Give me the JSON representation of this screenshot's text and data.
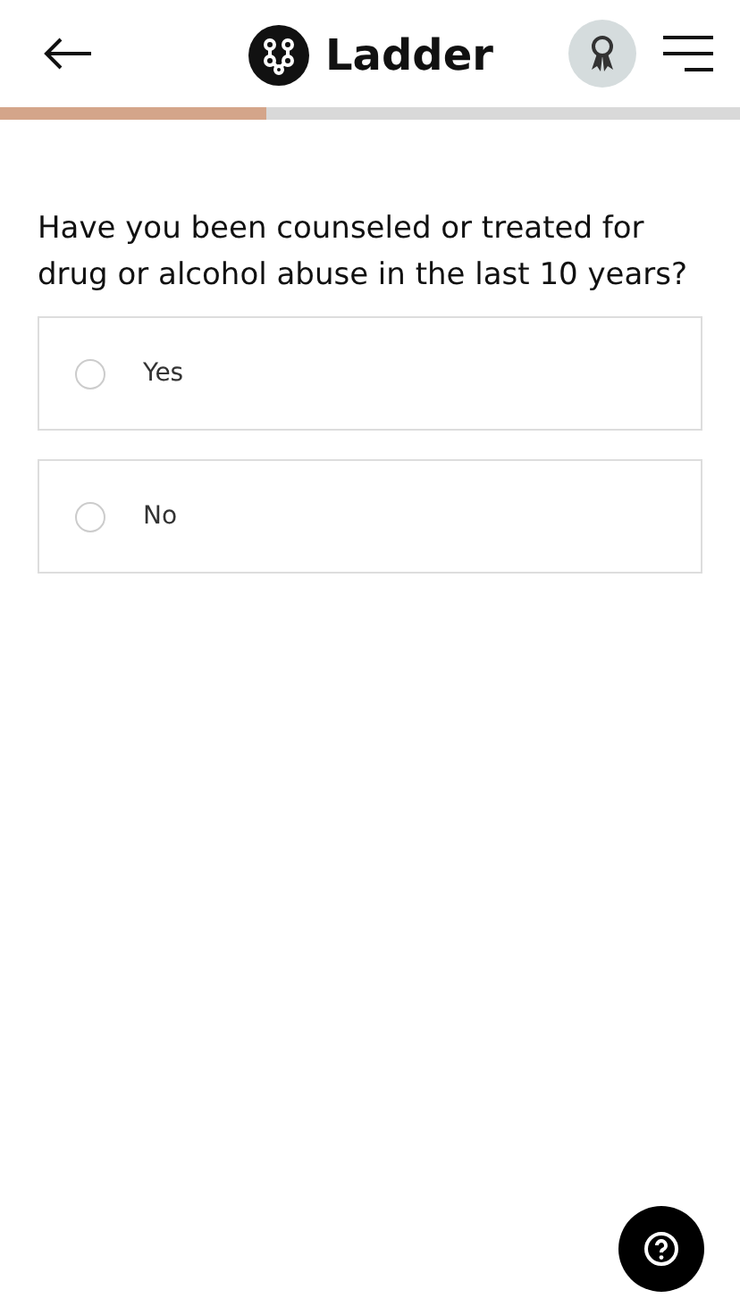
{
  "header": {
    "logo_text": "Ladder"
  },
  "progress": {
    "level": 0.36
  },
  "question": "Have you been counseled or treated for drug or alcohol abuse in the last 10 years?",
  "options": [
    {
      "label": "Yes",
      "selected": false
    },
    {
      "label": "No",
      "selected": false
    }
  ]
}
